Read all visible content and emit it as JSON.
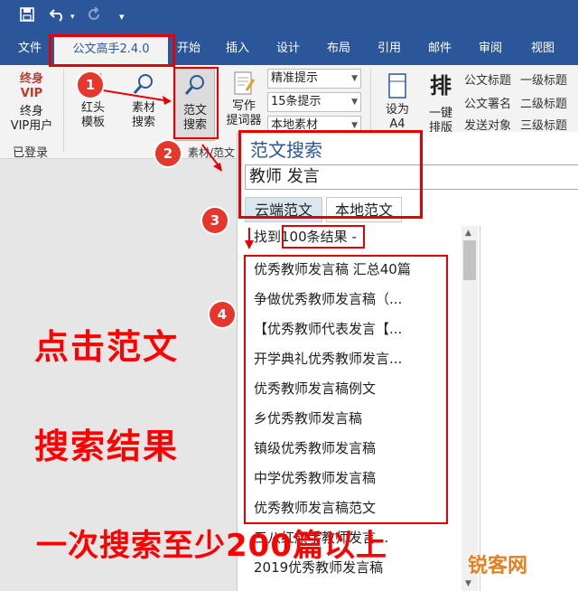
{
  "quick_access": {
    "save_icon": "save-icon",
    "undo_icon": "undo-icon",
    "redo_icon": "redo-icon",
    "customize_icon": "customize-icon"
  },
  "tabs": [
    {
      "label": "文件"
    },
    {
      "label": "公文高手2.4.0"
    },
    {
      "label": "开始"
    },
    {
      "label": "插入"
    },
    {
      "label": "设计"
    },
    {
      "label": "布局"
    },
    {
      "label": "引用"
    },
    {
      "label": "邮件"
    },
    {
      "label": "审阅"
    },
    {
      "label": "视图"
    }
  ],
  "ribbon": {
    "vip_top": "终身",
    "vip_bottom": "VIP",
    "vip_label_1": "终身",
    "vip_label_2": "VIP用户",
    "logged_in": "已登录",
    "redhead_1": "红头",
    "redhead_2": "模板",
    "material_1": "素材",
    "material_2": "搜索",
    "sample_1": "范文",
    "sample_2": "搜索",
    "write_1": "写作",
    "write_2": "提词器",
    "group_label": "素材/范文",
    "combo_1": "精准提示",
    "combo_2": "15条提示",
    "combo_3": "本地素材",
    "setas_1": "设为",
    "setas_2": "A4",
    "sort_icon_text": "排",
    "sort_1": "一键",
    "sort_2": "排版",
    "heading_col1": [
      "公文标题",
      "公文署名",
      "发送对象"
    ],
    "heading_col2": [
      "一级标题",
      "二级标题",
      "三级标题"
    ]
  },
  "pane": {
    "title": "范文搜索",
    "query": "教师 发言",
    "tab_cloud": "云端范文",
    "tab_local": "本地范文",
    "found_prefix": "找到",
    "found_count": "100条结果",
    "found_suffix": "-",
    "results": [
      "优秀教师发言稿 汇总40篇",
      "争做优秀教师发言稿（...",
      "【优秀教师代表发言【...",
      "开学典礼优秀教师发言...",
      "优秀教师发言稿例文",
      "乡优秀教师发言稿",
      "镇级优秀教师发言稿",
      "中学优秀教师发言稿",
      "优秀教师发言稿范文",
      "三八红旗手教师发言...",
      "2019优秀教师发言稿"
    ]
  },
  "annotations": {
    "badge_1": "1",
    "badge_2": "2",
    "badge_3": "3",
    "badge_4": "4",
    "caption_1": "点击范文",
    "caption_2": "搜索结果",
    "caption_3": "一次搜索至少200篇以上",
    "watermark": "锐客网"
  },
  "colors": {
    "ribbon_blue": "#2b579a",
    "annotation_red": "#e60000"
  }
}
